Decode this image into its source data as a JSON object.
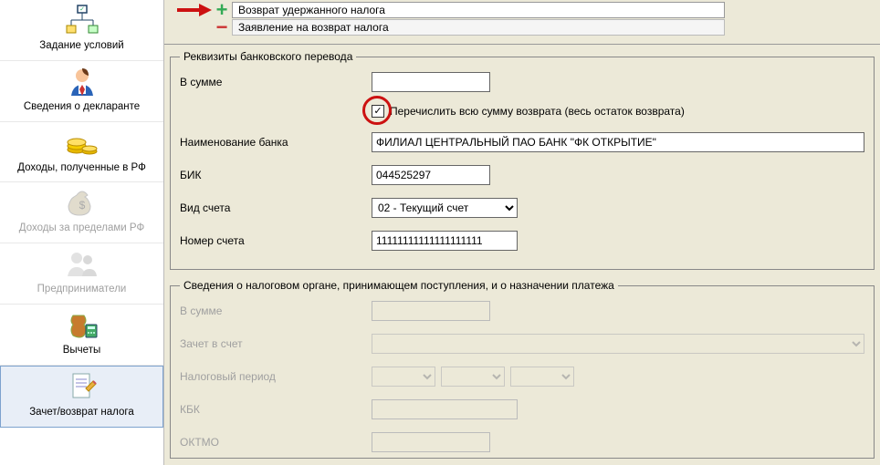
{
  "sidebar": {
    "items": [
      {
        "label": "Задание условий"
      },
      {
        "label": "Сведения о декларанте"
      },
      {
        "label": "Доходы, полученные в РФ"
      },
      {
        "label": "Доходы за пределами РФ"
      },
      {
        "label": "Предприниматели"
      },
      {
        "label": "Вычеты"
      },
      {
        "label": "Зачет/возврат налога"
      }
    ]
  },
  "topRows": {
    "r1": "Возврат удержанного налога",
    "r2": "Заявление на возврат налога"
  },
  "bank": {
    "legend": "Реквизиты банковского перевода",
    "sumLabel": "В сумме",
    "sumValue": "",
    "chkLabel": "Перечислить всю сумму возврата (весь остаток возврата)",
    "nameLabel": "Наименование банка",
    "nameValue": "ФИЛИАЛ ЦЕНТРАЛЬНЫЙ ПАО БАНК \"ФК ОТКРЫТИЕ\"",
    "bikLabel": "БИК",
    "bikValue": "044525297",
    "accTypeLabel": "Вид счета",
    "accTypeValue": "02 - Текущий счет",
    "accNumLabel": "Номер счета",
    "accNumValue": "11111111111111111111"
  },
  "tax": {
    "legend": "Сведения о налоговом органе, принимающем поступления, и о назначении платежа",
    "sumLabel": "В сумме",
    "creditLabel": "Зачет в счет",
    "periodLabel": "Налоговый период",
    "kbkLabel": "КБК",
    "oktmoLabel": "ОКТМО"
  }
}
